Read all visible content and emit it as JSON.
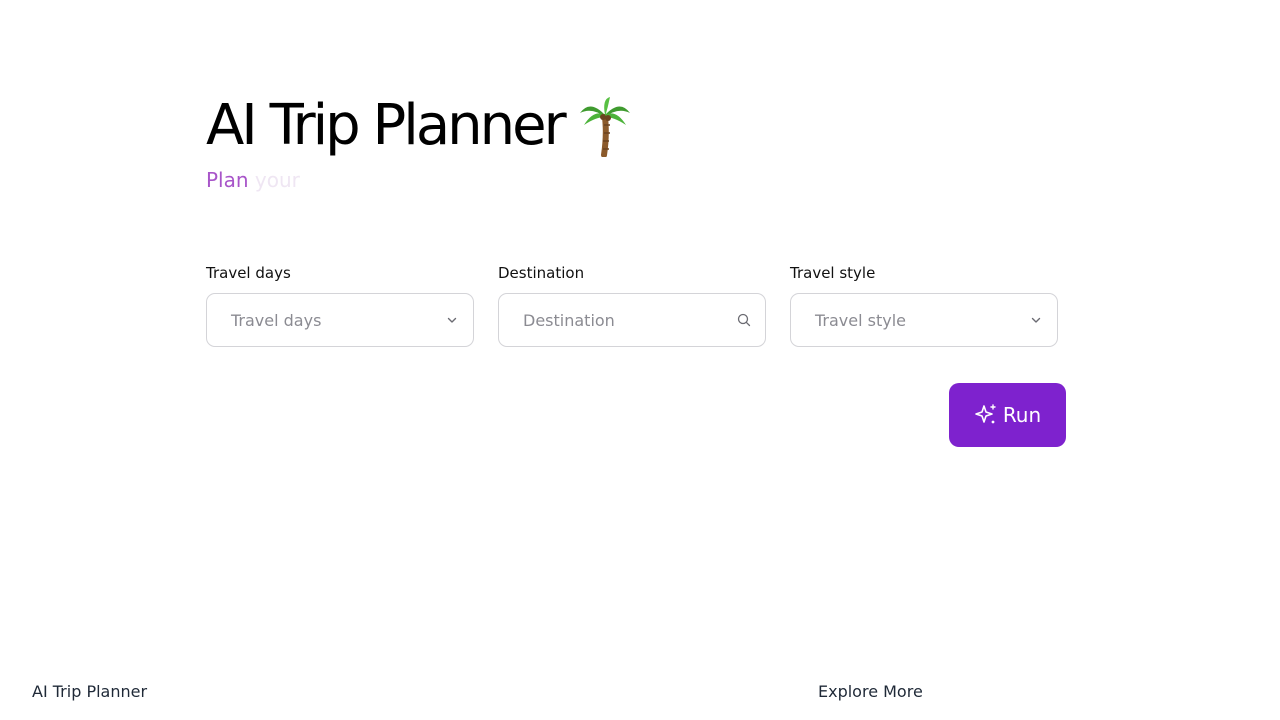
{
  "header": {
    "title": "AI Trip Planner",
    "title_icon": "palm-tree-icon",
    "subtitle_typed": "Plan",
    "subtitle_fading": "your"
  },
  "form": {
    "travel_days": {
      "label": "Travel days",
      "placeholder": "Travel days",
      "icon": "chevron-down-icon"
    },
    "destination": {
      "label": "Destination",
      "placeholder": "Destination",
      "icon": "search-icon"
    },
    "travel_style": {
      "label": "Travel style",
      "placeholder": "Travel style",
      "icon": "chevron-down-icon"
    }
  },
  "actions": {
    "run_label": "Run",
    "run_icon": "sparkle-icon"
  },
  "footer": {
    "brand": "AI Trip Planner",
    "explore_link": "Explore More"
  },
  "colors": {
    "accent": "#7e22ce",
    "subtitle_typed": "#a855c9",
    "subtitle_fading": "#efe6f3",
    "border": "#d4d4d8",
    "placeholder": "#8b8b92"
  }
}
